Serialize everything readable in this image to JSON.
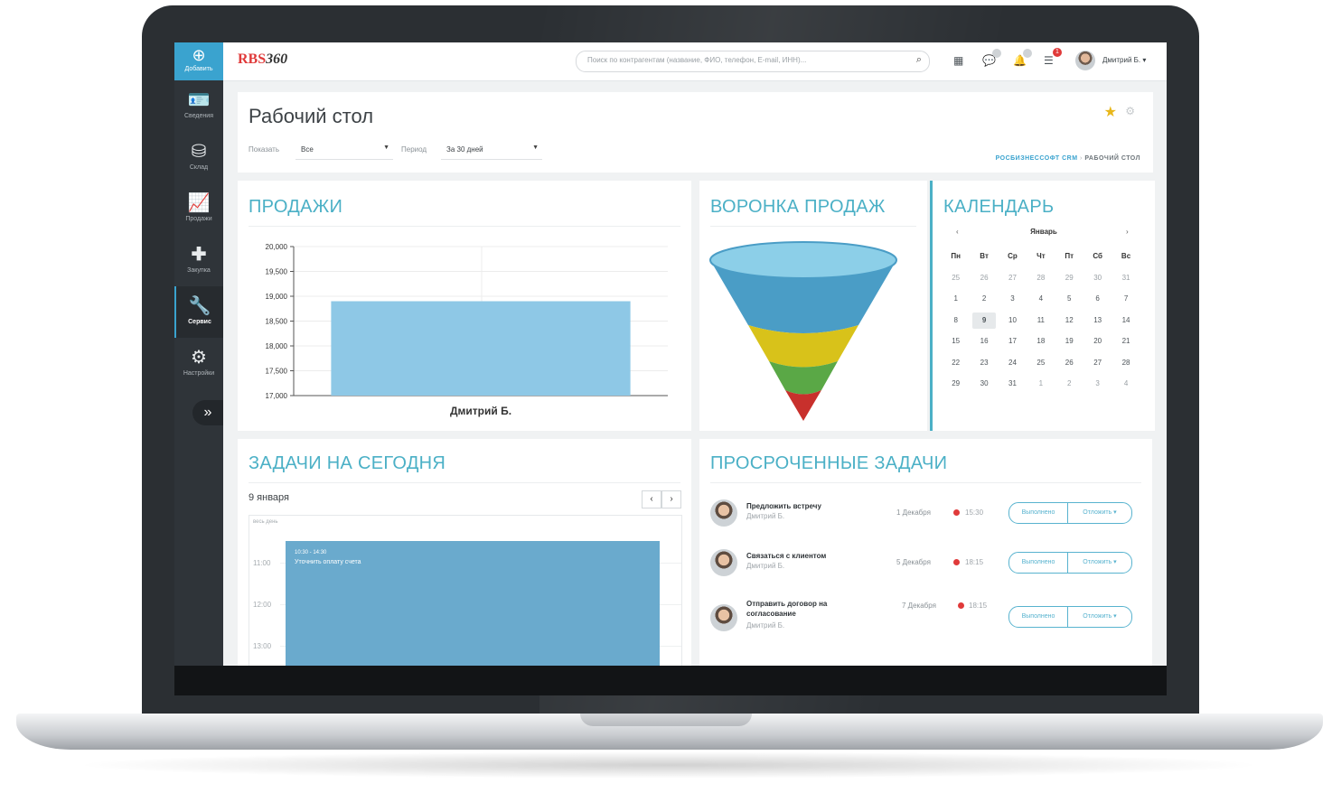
{
  "app": {
    "logo_text": "RBS",
    "logo_num": "360"
  },
  "sidebar": {
    "add_label": "Добавить",
    "items": [
      {
        "label": "Сведения",
        "icon": "id-card-icon"
      },
      {
        "label": "Склад",
        "icon": "boxes-icon"
      },
      {
        "label": "Продажи",
        "icon": "chart-line-icon"
      },
      {
        "label": "Закупка",
        "icon": "plus-icon"
      },
      {
        "label": "Сервис",
        "icon": "wrench-icon",
        "active": true
      },
      {
        "label": "Настройки",
        "icon": "gear-icon"
      }
    ]
  },
  "topbar": {
    "search_placeholder": "Поиск по контрагентам (название, ФИО, телефон, E-mail, ИНН)...",
    "notifications_badge": "1",
    "user_name": "Дмитрий Б. ▾"
  },
  "header": {
    "title": "Рабочий стол",
    "show_label": "Показать",
    "show_value": "Все",
    "period_label": "Период",
    "period_value": "За 30 дней",
    "breadcrumb_1": "РОСБИЗНЕССОФТ CRM",
    "breadcrumb_sep": "›",
    "breadcrumb_2": "РАБОЧИЙ СТОЛ"
  },
  "sales": {
    "title": "ПРОДАЖИ",
    "chart_data": {
      "type": "bar",
      "categories": [
        "Дмитрий Б."
      ],
      "values": [
        18900
      ],
      "ylim": [
        17000,
        20000
      ],
      "yticks": [
        17000,
        17500,
        18000,
        18500,
        19000,
        19500,
        20000
      ],
      "ytick_labels": [
        "17,000",
        "17,500",
        "18,000",
        "18,500",
        "19,000",
        "19,500",
        "20,000"
      ],
      "bar_color": "#8ec8e6",
      "grid": true
    }
  },
  "funnel": {
    "title": "ВОРОНКА ПРОДАЖ",
    "colors": [
      "#8ccfe8",
      "#4a9dc6",
      "#d8c21a",
      "#5aa846",
      "#c8302c"
    ]
  },
  "calendar": {
    "title": "КАЛЕНДАРЬ",
    "month": "Январь",
    "prev": "‹",
    "next": "›",
    "weekdays": [
      "Пн",
      "Вт",
      "Ср",
      "Чт",
      "Пт",
      "Сб",
      "Вс"
    ],
    "weeks": [
      [
        "25",
        "26",
        "27",
        "28",
        "29",
        "30",
        "31"
      ],
      [
        "1",
        "2",
        "3",
        "4",
        "5",
        "6",
        "7"
      ],
      [
        "8",
        "9",
        "10",
        "11",
        "12",
        "13",
        "14"
      ],
      [
        "15",
        "16",
        "17",
        "18",
        "19",
        "20",
        "21"
      ],
      [
        "22",
        "23",
        "24",
        "25",
        "26",
        "27",
        "28"
      ],
      [
        "29",
        "30",
        "31",
        "1",
        "2",
        "3",
        "4"
      ]
    ],
    "today": "9"
  },
  "today_tasks": {
    "title": "ЗАДАЧИ НА СЕГОДНЯ",
    "date": "9 января",
    "prev": "‹",
    "next": "›",
    "allday": "весь день",
    "hours": [
      "11:00",
      "12:00",
      "13:00"
    ],
    "event_time": "10:30 - 14:30",
    "event_title": "Уточнить оплату счета"
  },
  "overdue": {
    "title": "ПРОСРОЧЕННЫЕ ЗАДАЧИ",
    "done_label": "Выполнено",
    "postpone_label": "Отложить ▾",
    "tasks": [
      {
        "title": "Предложить встречу",
        "user": "Дмитрий Б.",
        "date": "1 Декабря",
        "time": "15:30"
      },
      {
        "title": "Связаться с клиентом",
        "user": "Дмитрий Б.",
        "date": "5 Декабря",
        "time": "18:15"
      },
      {
        "title": "Отправить договор на согласование",
        "user": "Дмитрий Б.",
        "date": "7 Декабря",
        "time": "18:15"
      }
    ]
  }
}
